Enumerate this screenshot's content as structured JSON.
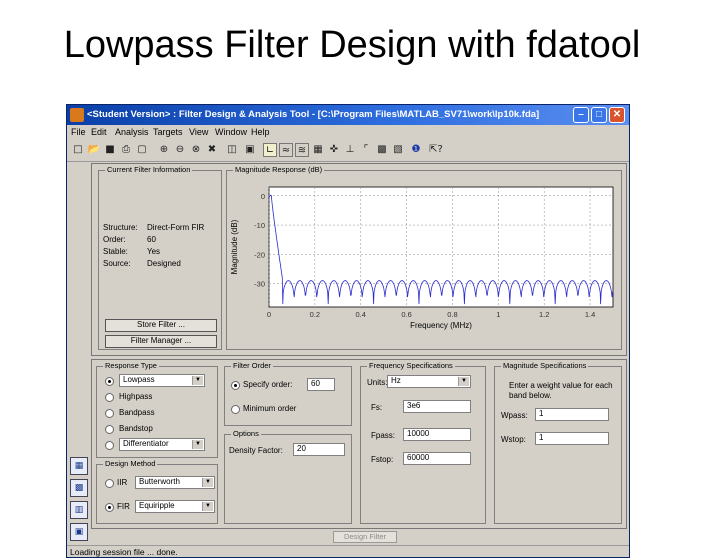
{
  "slide_title": "Lowpass Filter Design with fdatool",
  "window": {
    "title": "<Student Version> : Filter Design & Analysis Tool - [C:\\Program Files\\MATLAB_SV71\\work\\lp10k.fda]",
    "menu": [
      "File",
      "Edit",
      "Analysis",
      "Targets",
      "View",
      "Window",
      "Help"
    ]
  },
  "current_filter": {
    "label": "Current Filter Information",
    "structure_label": "Structure:",
    "structure_value": "Direct-Form FIR",
    "order_label": "Order:",
    "order_value": "60",
    "stable_label": "Stable:",
    "stable_value": "Yes",
    "source_label": "Source:",
    "source_value": "Designed",
    "store_button": "Store Filter ...",
    "manager_button": "Filter Manager ..."
  },
  "magnitude_panel": {
    "label": "Magnitude Response (dB)"
  },
  "chart_data": {
    "type": "line",
    "title": "",
    "xlabel": "Frequency (MHz)",
    "ylabel": "Magnitude (dB)",
    "xlim": [
      0,
      1.5
    ],
    "ylim": [
      -38,
      3
    ],
    "xticks": [
      0,
      0.2,
      0.4,
      0.6,
      0.8,
      1,
      1.2,
      1.4
    ],
    "xtick_labels": [
      "0",
      "0.2",
      "0.4",
      "0.6",
      "0.8",
      "1",
      "1.2",
      "1.4"
    ],
    "yticks": [
      0,
      -10,
      -20,
      -30
    ],
    "ytick_labels": [
      "0",
      "-10",
      "-20",
      "-30"
    ],
    "grid": true,
    "series": [
      {
        "color": "#2a2ad0",
        "passband_edge_mhz": 0.01,
        "stopband_edge_mhz": 0.06,
        "stopband_top_db": -29,
        "stopband_bottom_db": -37,
        "passband_db": 0
      }
    ]
  },
  "response_type": {
    "label": "Response Type",
    "lowpass": "Lowpass",
    "highpass": "Highpass",
    "bandpass": "Bandpass",
    "bandstop": "Bandstop",
    "differentiator": "Differentiator",
    "selected": "Lowpass"
  },
  "design_method": {
    "label": "Design Method",
    "iir": "IIR",
    "iir_select": "Butterworth",
    "fir": "FIR",
    "fir_select": "Equiripple",
    "selected": "FIR"
  },
  "filter_order": {
    "label": "Filter Order",
    "specify": "Specify order:",
    "specify_value": "60",
    "minimum": "Minimum order"
  },
  "options": {
    "label": "Options",
    "density_label": "Density Factor:",
    "density_value": "20"
  },
  "frequency_specs": {
    "label": "Frequency Specifications",
    "units_label": "Units:",
    "units_value": "Hz",
    "fs_label": "Fs:",
    "fs_value": "3e6",
    "fpass_label": "Fpass:",
    "fpass_value": "10000",
    "fstop_label": "Fstop:",
    "fstop_value": "60000"
  },
  "magnitude_specs": {
    "label": "Magnitude Specifications",
    "hint": "Enter a weight value for each band below.",
    "wpass_label": "Wpass:",
    "wpass_value": "1",
    "wstop_label": "Wstop:",
    "wstop_value": "1"
  },
  "design_button": "Design Filter",
  "status": "Loading session file ... done."
}
